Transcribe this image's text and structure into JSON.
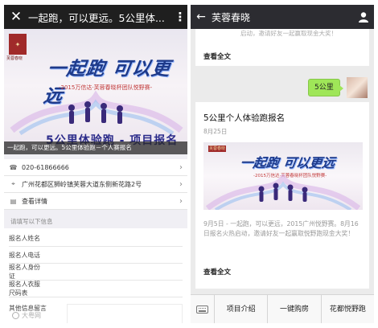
{
  "left": {
    "topbar": {
      "close_icon": "close-icon",
      "title": "一起跑，可以更远。5公里体...",
      "more_icon": "more-vertical-icon"
    },
    "banner": {
      "logo_text": "芙蓉春晓",
      "logo_subtext": "芙蓉春晓",
      "slogan": "一起跑 可以更远",
      "subtitle": "-2015万信达·芙蓉春晓杯团队悦野赛-",
      "event_title": "5公里体验跑 - 项目报名",
      "caption": "一起跑，可以更远。5公里体验跑－个人赛报名"
    },
    "info_items": [
      {
        "icon": "phone-icon",
        "text": "020-61866666"
      },
      {
        "icon": "location-icon",
        "text": "广州花都区狮岭镇芙蓉大道东侧新花路2号"
      },
      {
        "icon": "details-icon",
        "text": "查看详情"
      }
    ],
    "form": {
      "header": "请填写以下信息",
      "fields": [
        {
          "label": "报名人姓名",
          "value": ""
        },
        {
          "label": "报名人电话",
          "value": ""
        },
        {
          "label": "报名人身份证",
          "value": ""
        },
        {
          "label": "报名人衣服尺码表",
          "value": ""
        }
      ],
      "message_label": "其他信息留言",
      "message_value": ""
    },
    "watermark": "大粤网"
  },
  "right": {
    "topbar": {
      "back_icon": "back-arrow-icon",
      "title": "芙蓉春晓",
      "user_icon": "person-icon"
    },
    "top_card": {
      "cut_text": "启动，邀请好友一起赢取现金大奖！",
      "read_all": "查看全文"
    },
    "sent_message": "5公里",
    "article": {
      "title": "5公里个人体验跑报名",
      "date": "8月25日",
      "image_logo": "芙蓉春晓",
      "image_slogan": "一起跑 可以更远",
      "image_subtitle": "-2015万信达·芙蓉春晓杯团队悦野赛-",
      "description": "9月5日 - 一起跑，可以更远，2015广州悦野赛。8月16日报名火热启动，邀请好友一起赢取悦野跑现金大奖！",
      "read_all": "查看全文"
    },
    "bottom_menu": {
      "keyboard_icon": "keyboard-icon",
      "items": [
        "项目介绍",
        "一键购房",
        "花都悦野跑"
      ]
    }
  }
}
